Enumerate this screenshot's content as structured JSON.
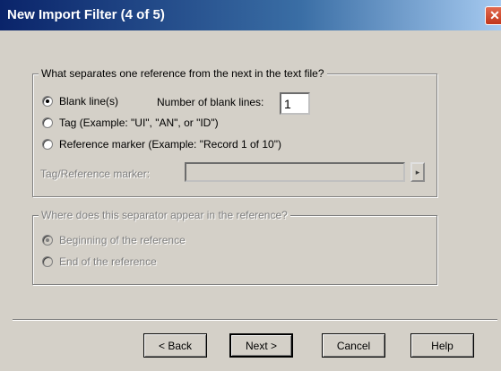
{
  "window": {
    "title": "New Import Filter (4 of 5)",
    "close_glyph": "✕"
  },
  "separator_group": {
    "legend": "What separates one reference from the next in the text file?",
    "options": [
      {
        "label": "Blank line(s)",
        "checked": true
      },
      {
        "label": "Tag  (Example:  \"UI\", \"AN\", or \"ID\")",
        "checked": false
      },
      {
        "label": "Reference marker  (Example:  \"Record 1 of 10\")",
        "checked": false
      }
    ],
    "blank_lines_label": "Number of blank lines:",
    "blank_lines_value": "1",
    "tag_marker_label": "Tag/Reference marker:",
    "tag_marker_value": "",
    "arrow_glyph": "▸"
  },
  "position_group": {
    "legend": "Where does this separator appear in the reference?",
    "options": [
      {
        "label": "Beginning of the reference",
        "checked": true
      },
      {
        "label": "End of the reference",
        "checked": false
      }
    ]
  },
  "buttons": {
    "back": "< Back",
    "next": "Next >",
    "cancel": "Cancel",
    "help": "Help"
  }
}
